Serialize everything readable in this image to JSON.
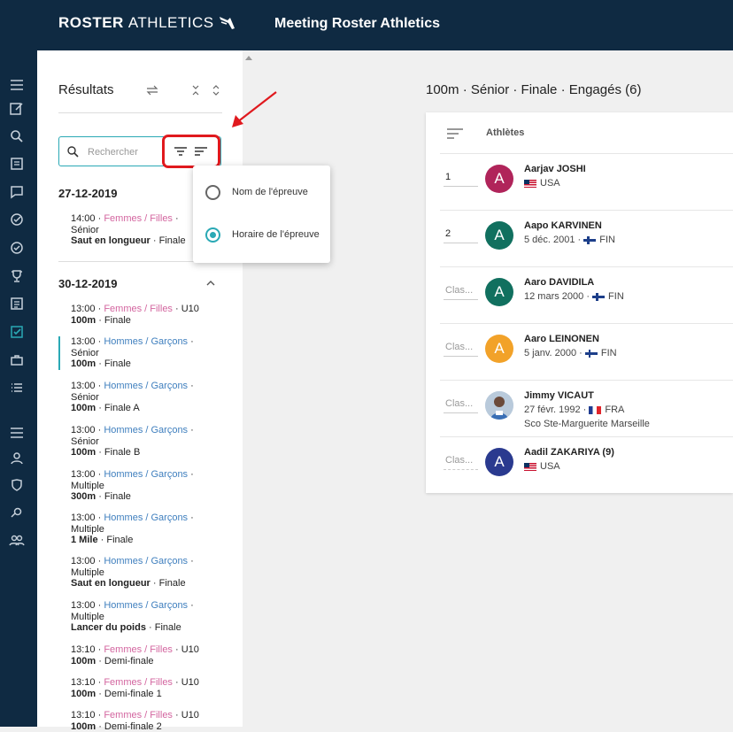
{
  "header": {
    "logo_bold": "ROSTER",
    "logo_light": "ATHLETICS",
    "title": "Meeting Roster Athletics"
  },
  "sidebar_icons": [
    "menu-icon",
    "edit-icon",
    "search-icon",
    "document-icon",
    "chat-icon",
    "check-circle-icon",
    "check-circle-icon",
    "trophy-icon",
    "list-document-icon",
    "checkbox-icon",
    "briefcase-icon",
    "bulleted-list-icon",
    "menu-icon",
    "person-icon",
    "shield-icon",
    "whistle-icon",
    "group-icon"
  ],
  "panel": {
    "title": "Résultats",
    "search_placeholder": "Rechercher"
  },
  "sort_menu": {
    "options": [
      "Nom de l'épreuve",
      "Horaire de l'épreuve"
    ],
    "selected": "Horaire de l'épreuve"
  },
  "days": [
    {
      "date": "27-12-2019",
      "events": [
        {
          "time": "14:00",
          "group": "Femmes / Filles",
          "category": "Sénior",
          "discipline": "Saut en longueur",
          "round": "Finale"
        }
      ]
    },
    {
      "date": "30-12-2019",
      "events": [
        {
          "time": "13:00",
          "group": "Femmes / Filles",
          "category": "U10",
          "discipline": "100m",
          "round": "Finale"
        },
        {
          "time": "13:00",
          "group": "Hommes / Garçons",
          "category": "Sénior",
          "discipline": "100m",
          "round": "Finale"
        },
        {
          "time": "13:00",
          "group": "Hommes / Garçons",
          "category": "Sénior",
          "discipline": "100m",
          "round": "Finale A"
        },
        {
          "time": "13:00",
          "group": "Hommes / Garçons",
          "category": "Sénior",
          "discipline": "100m",
          "round": "Finale B"
        },
        {
          "time": "13:00",
          "group": "Hommes / Garçons",
          "category": "Multiple",
          "discipline": "300m",
          "round": "Finale"
        },
        {
          "time": "13:00",
          "group": "Hommes / Garçons",
          "category": "Multiple",
          "discipline": "1 Mile",
          "round": "Finale"
        },
        {
          "time": "13:00",
          "group": "Hommes / Garçons",
          "category": "Multiple",
          "discipline": "Saut en longueur",
          "round": "Finale"
        },
        {
          "time": "13:00",
          "group": "Hommes / Garçons",
          "category": "Multiple",
          "discipline": "Lancer du poids",
          "round": "Finale"
        },
        {
          "time": "13:10",
          "group": "Femmes / Filles",
          "category": "U10",
          "discipline": "100m",
          "round": "Demi-finale"
        },
        {
          "time": "13:10",
          "group": "Femmes / Filles",
          "category": "U10",
          "discipline": "100m",
          "round": "Demi-finale 1"
        },
        {
          "time": "13:10",
          "group": "Femmes / Filles",
          "category": "U10",
          "discipline": "100m",
          "round": "Demi-finale 2"
        }
      ]
    }
  ],
  "main": {
    "title": "100m · Sénior · Finale · Engagés (6)",
    "column_header": "Athlètes",
    "athletes": [
      {
        "rank": "1",
        "name": "Aarjav JOSHI",
        "dob": "",
        "country": "USA",
        "flag": "usa",
        "club": "",
        "initial": "A",
        "color": "#b0245a"
      },
      {
        "rank": "2",
        "name": "Aapo KARVINEN",
        "dob": "5 déc. 2001",
        "country": "FIN",
        "flag": "fin",
        "club": "",
        "initial": "A",
        "color": "#11705f"
      },
      {
        "rank": "",
        "placeholder": "Clas...",
        "name": "Aaro DAVIDILA",
        "dob": "12 mars 2000",
        "country": "FIN",
        "flag": "fin",
        "club": "",
        "initial": "A",
        "color": "#11705f"
      },
      {
        "rank": "",
        "placeholder": "Clas...",
        "name": "Aaro LEINONEN",
        "dob": "5 janv. 2000",
        "country": "FIN",
        "flag": "fin",
        "club": "",
        "initial": "A",
        "color": "#f2a229"
      },
      {
        "rank": "",
        "placeholder": "Clas...",
        "name": "Jimmy VICAUT",
        "dob": "27 févr. 1992",
        "country": "FRA",
        "flag": "fra",
        "club": "Sco Ste-Marguerite Marseille",
        "initial": "",
        "color": "#c9d6e4"
      },
      {
        "rank": "",
        "placeholder": "Clas...",
        "name": "Aadil ZAKARIYA (9)",
        "dob": "",
        "country": "USA",
        "flag": "usa",
        "club": "",
        "initial": "A",
        "color": "#2a3a8f"
      }
    ]
  },
  "colors": {
    "header": "#0f2a42",
    "accent": "#2aa9b5",
    "female": "#d3659f",
    "male": "#3f7fbe",
    "highlight": "#e0191e"
  }
}
